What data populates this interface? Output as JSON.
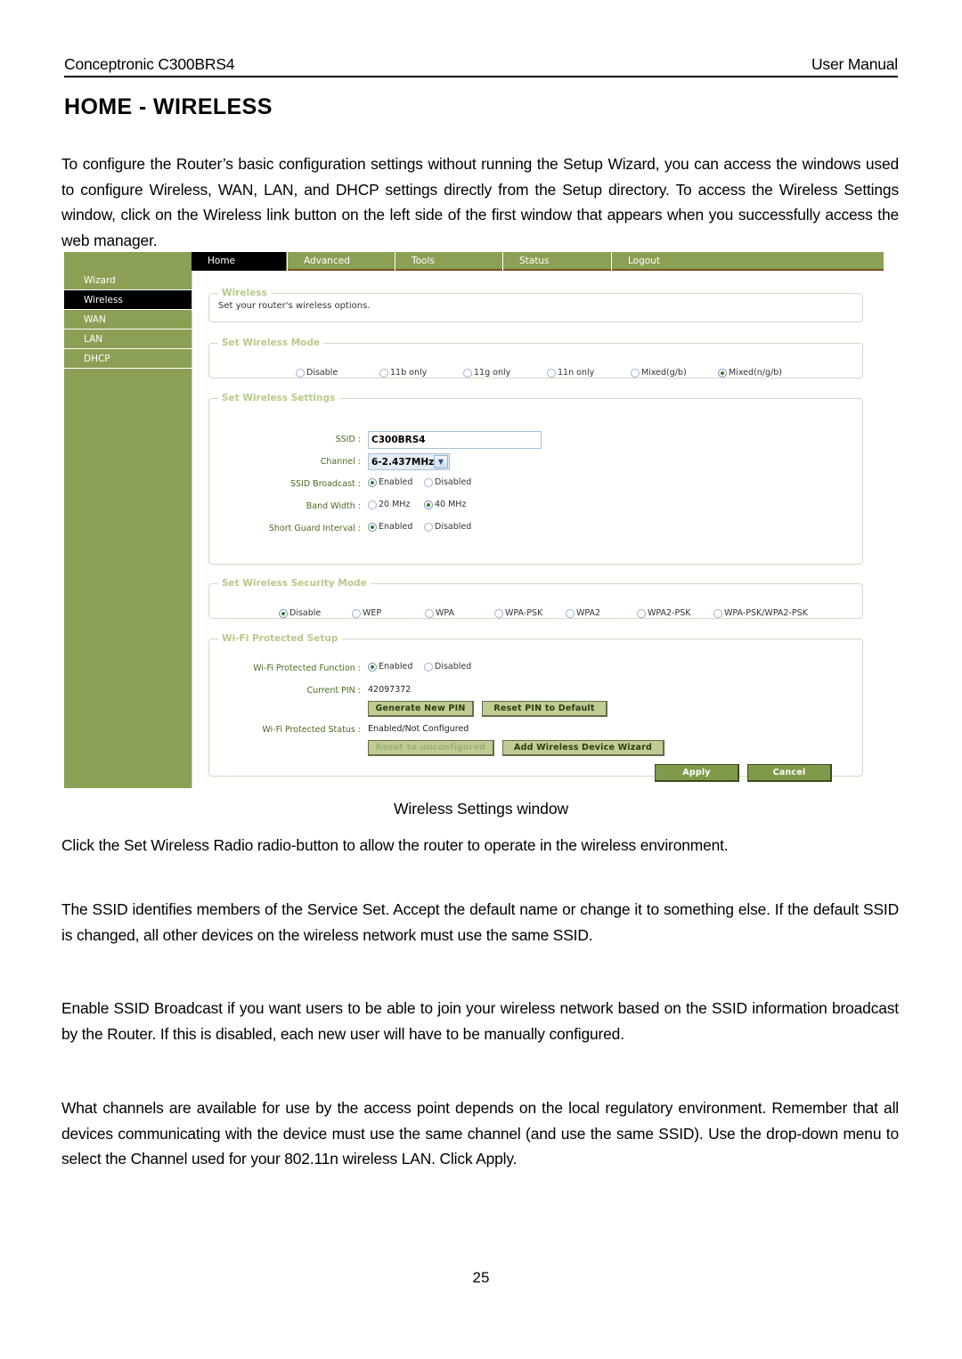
{
  "header": {
    "left": "Conceptronic C300BRS4",
    "right": "User Manual"
  },
  "doc_title": "HOME - WIRELESS",
  "intro_paragraph": "To configure the Router’s basic configuration settings without running the Setup Wizard, you can access the windows used to configure Wireless, WAN, LAN, and DHCP settings directly from the Setup directory. To access the Wireless Settings window, click on the Wireless link button on the left side of the first window that appears when you successfully access the web manager.",
  "figure_caption": "Wireless Settings window",
  "paragraphs": [
    "Click the Set Wireless Radio radio-button to allow the router to operate in the wireless environment.",
    "The SSID identifies members of the Service Set. Accept the default name or change it to something else. If the default SSID is changed, all other devices on the wireless network must use the same SSID.",
    "Enable SSID Broadcast if you want users to be able to join your wireless network based on the SSID information broadcast by the Router. If this is disabled, each new user will have to be manually configured.",
    "What channels are available for use by the access point depends on the local regulatory environment. Remember that all devices communicating with the device must use the same channel (and use the same SSID). Use the drop-down menu to select the Channel used for your 802.11n wireless LAN. Click Apply."
  ],
  "page_number": "25",
  "colors": {
    "brand_green": "#8ba055",
    "button_green": "#bdcd93",
    "primary_button": "#7f9a4a",
    "legend_green": "#b6c98a",
    "label_green": "#4a6b22",
    "active_black": "#000000"
  },
  "router_ui": {
    "nav_tabs": [
      {
        "label": "Home",
        "active": true
      },
      {
        "label": "Advanced",
        "active": false
      },
      {
        "label": "Tools",
        "active": false
      },
      {
        "label": "Status",
        "active": false
      },
      {
        "label": "Logout",
        "active": false
      }
    ],
    "sidebar": [
      {
        "label": "Wizard",
        "active": false
      },
      {
        "label": "Wireless",
        "active": true
      },
      {
        "label": "WAN",
        "active": false
      },
      {
        "label": "LAN",
        "active": false
      },
      {
        "label": "DHCP",
        "active": false
      }
    ],
    "wireless_box": {
      "legend": "Wireless",
      "description": "Set your router's wireless options."
    },
    "wireless_mode": {
      "legend": "Set Wireless Mode",
      "options": [
        {
          "label": "Disable",
          "checked": false
        },
        {
          "label": "11b only",
          "checked": false
        },
        {
          "label": "11g only",
          "checked": false
        },
        {
          "label": "11n only",
          "checked": false
        },
        {
          "label": "Mixed(g/b)",
          "checked": false
        },
        {
          "label": "Mixed(n/g/b)",
          "checked": true
        }
      ]
    },
    "wireless_settings": {
      "legend": "Set Wireless Settings",
      "ssid_label": "SSID :",
      "ssid_value": "C300BRS4",
      "channel_label": "Channel :",
      "channel_value": "6-2.437MHz",
      "ssid_broadcast_label": "SSID Broadcast :",
      "ssid_broadcast": [
        {
          "label": "Enabled",
          "checked": true
        },
        {
          "label": "Disabled",
          "checked": false
        }
      ],
      "band_width_label": "Band Width :",
      "band_width": [
        {
          "label": "20 MHz",
          "checked": false
        },
        {
          "label": "40 MHz",
          "checked": true
        }
      ],
      "short_guard_label": "Short Guard Interval :",
      "short_guard": [
        {
          "label": "Enabled",
          "checked": true
        },
        {
          "label": "Disabled",
          "checked": false
        }
      ]
    },
    "security_mode": {
      "legend": "Set Wireless Security Mode",
      "options": [
        {
          "label": "Disable",
          "checked": true
        },
        {
          "label": "WEP",
          "checked": false
        },
        {
          "label": "WPA",
          "checked": false
        },
        {
          "label": "WPA-PSK",
          "checked": false
        },
        {
          "label": "WPA2",
          "checked": false
        },
        {
          "label": "WPA2-PSK",
          "checked": false
        },
        {
          "label": "WPA-PSK/WPA2-PSK",
          "checked": false
        }
      ]
    },
    "wps": {
      "legend": "Wi-Fi Protected Setup",
      "function_label": "Wi-Fi Protected Function :",
      "function_options": [
        {
          "label": "Enabled",
          "checked": true
        },
        {
          "label": "Disabled",
          "checked": false
        }
      ],
      "current_pin_label": "Current PIN :",
      "current_pin_value": "42097372",
      "generate_pin_button": "Generate New PIN",
      "reset_pin_button": "Reset PIN to Default",
      "status_label": "Wi-Fi Protected Status :",
      "status_value": "Enabled/Not Configured",
      "reset_unconfigured_button": "Reset to unconfigured",
      "add_device_button": "Add Wireless Device Wizard"
    },
    "actions": {
      "apply_button": "Apply",
      "cancel_button": "Cancel"
    }
  }
}
